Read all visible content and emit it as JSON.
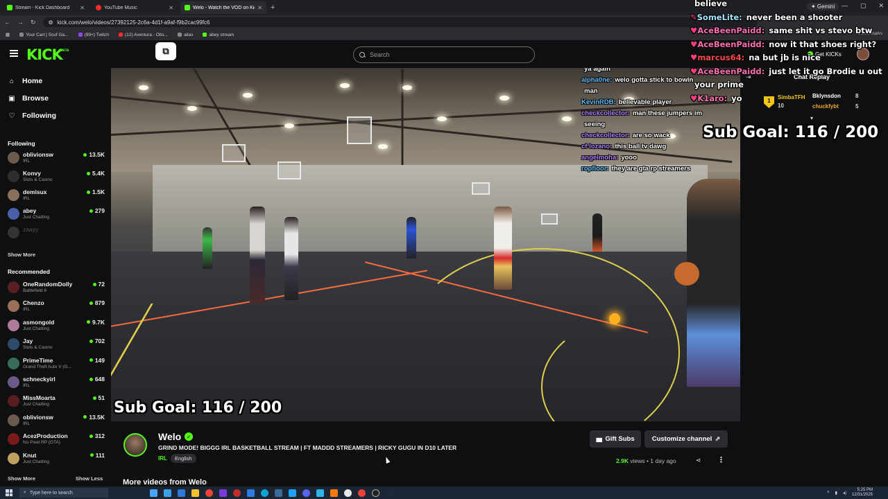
{
  "browser": {
    "tabs": [
      {
        "label": "Stream - Kick Dashboard",
        "favicon": "kick-icon",
        "active": false
      },
      {
        "label": "YouTube Music",
        "favicon": "youtube-music-icon",
        "active": false
      },
      {
        "label": "Welo - Watch the VOD on Kick",
        "favicon": "kick-icon",
        "active": true
      }
    ],
    "new_tab": "+",
    "url": "kick.com/welo/videos/27392125-2c6a-4d1f-a9af-f9b2cac99fc6",
    "bookmarks": [
      "Your Cart | Scuf Ga...",
      "(99+) Twitch",
      "(12) Aventura - Obs...",
      "alias",
      "abey stream"
    ],
    "all_bookmarks": "All Bookmarks",
    "gemini": "✦ Gemini"
  },
  "header": {
    "logo": "KICK",
    "logo_badge": "BETA",
    "search_placeholder": "Search",
    "get_kicks": "Get KICKs"
  },
  "nav": [
    {
      "label": "Home",
      "icon": "home-icon"
    },
    {
      "label": "Browse",
      "icon": "browse-icon"
    },
    {
      "label": "Following",
      "icon": "heart-icon"
    }
  ],
  "following": {
    "heading": "Following",
    "channels": [
      {
        "name": "oblivionsw",
        "category": "IRL",
        "viewers": "13.5K",
        "live": true,
        "avatar_color": "#6b5a4e"
      },
      {
        "name": "Konvy",
        "category": "Slots & Casino",
        "viewers": "5.4K",
        "live": true,
        "avatar_color": "#2e2e2e"
      },
      {
        "name": "demisux",
        "category": "IRL",
        "viewers": "1.5K",
        "live": true,
        "avatar_color": "#8a6f5a"
      },
      {
        "name": "abey",
        "category": "Just Chatting",
        "viewers": "279",
        "live": true,
        "avatar_color": "#4a5fa8"
      },
      {
        "name": "zaayy",
        "category": "",
        "viewers": "",
        "live": false,
        "avatar_color": "#333333"
      }
    ],
    "show_more": "Show More"
  },
  "recommended": {
    "heading": "Recommended",
    "channels": [
      {
        "name": "OneRandomDolly",
        "category": "Battlefield 6",
        "viewers": "72",
        "avatar_color": "#5a1f25"
      },
      {
        "name": "Chenzo",
        "category": "IRL",
        "viewers": "879",
        "avatar_color": "#9b7058"
      },
      {
        "name": "asmongold",
        "category": "Just Chatting",
        "viewers": "9.7K",
        "avatar_color": "#b07a9a"
      },
      {
        "name": "Jay",
        "category": "Slots & Casino",
        "viewers": "702",
        "avatar_color": "#2f4b6b"
      },
      {
        "name": "PrimeTime",
        "category": "Grand Theft Auto V (G...",
        "viewers": "149",
        "avatar_color": "#3a6a5a"
      },
      {
        "name": "schneckyirl",
        "category": "IRL",
        "viewers": "648",
        "avatar_color": "#6a5a8a"
      },
      {
        "name": "MissMoarta",
        "category": "Just Chatting",
        "viewers": "51",
        "avatar_color": "#5a1d20"
      },
      {
        "name": "oblivionsw",
        "category": "IRL",
        "viewers": "13.5K",
        "avatar_color": "#6b5a4e"
      },
      {
        "name": "AcezProduction",
        "category": "No Pixel RP (GTA)",
        "viewers": "312",
        "avatar_color": "#7a1a1a"
      },
      {
        "name": "Knut",
        "category": "Just Chatting",
        "viewers": "111",
        "avatar_color": "#c0a060"
      }
    ],
    "show_more": "Show More",
    "show_less": "Show Less"
  },
  "video": {
    "sub_goal": "Sub Goal:  116 / 200",
    "chat_overlay": [
      {
        "user": "",
        "text": "ya again",
        "color": "#ffffff"
      },
      {
        "user": "alpha0ne:",
        "text": "welo gotta stick to bowin",
        "color": "#5ec3ff"
      },
      {
        "user": "",
        "text": "man",
        "color": "#ffffff"
      },
      {
        "user": "KevinRDB:",
        "text": "believable player",
        "color": "#5ec3ff"
      },
      {
        "user": "checkcollector:",
        "text": "man these jumpers im",
        "color": "#b07cff"
      },
      {
        "user": "",
        "text": "seeing",
        "color": "#ffffff"
      },
      {
        "user": "checkcollector:",
        "text": "are so wack",
        "color": "#b07cff"
      },
      {
        "user": "cf lozano:",
        "text": "this ball tv dawg",
        "color": "#b07cff"
      },
      {
        "user": "angelmoha:",
        "text": "yooo",
        "color": "#b07cff"
      },
      {
        "user": "ropfloor:",
        "text": "they are gta rp streamers",
        "color": "#5ec3ff"
      }
    ]
  },
  "overlay_chat": [
    {
      "user": "",
      "text": "believe",
      "color": "#ffffff",
      "badge": ""
    },
    {
      "user": "SomeLite:",
      "text": "never been a shooter",
      "color": "#a6e3ff",
      "badge": "✎"
    },
    {
      "user": "AceBeenPaidd:",
      "text": "same shit vs stevo btw",
      "color": "#ff6fb0",
      "badge": "♥"
    },
    {
      "user": "AceBeenPaidd:",
      "text": "now it that shoes right?",
      "color": "#ff6fb0",
      "badge": "♥"
    },
    {
      "user": "marcus64:",
      "text": "na but jb is nice",
      "color": "#ff4a4a",
      "badge": "♥"
    },
    {
      "user": "AceBeenPaidd:",
      "text": "just let it go Brodie u out",
      "color": "#ff6fb0",
      "badge": "♥"
    },
    {
      "user": "",
      "text": "your prime",
      "color": "#ffffff",
      "badge": ""
    },
    {
      "user": "K1aro:",
      "text": "yo",
      "color": "#ff6fb0",
      "badge": "♥"
    }
  ],
  "overlay_sub_goal": "Sub Goal:  116 / 200",
  "chat_panel": {
    "title": "Chat Replay",
    "leaderboard": [
      {
        "name": "SimbaTFH",
        "count": "10",
        "color": "#f5c518"
      },
      {
        "name": "Bklynsdon",
        "count": "8",
        "color": "#ffffff"
      },
      {
        "name": "chuckfybt",
        "count": "5",
        "color": "#f5a623"
      }
    ]
  },
  "channel": {
    "name": "Welo",
    "title": "GRIND MODE! BIGGG IRL BASKETBALL STREAM | FT MADDD STREAMERS | RICKY GUGU IN D10 LATER",
    "category": "IRL",
    "language": "English",
    "gift_subs": "Gift Subs",
    "customize": "Customize channel",
    "views": "2.9K",
    "views_label": " views",
    "separator": " • ",
    "time_ago": "1 day ago",
    "more_videos": "More videos from Welo"
  },
  "taskbar": {
    "search_placeholder": "Type here to search",
    "time": "5:25 PM",
    "date": "12/31/2025"
  }
}
